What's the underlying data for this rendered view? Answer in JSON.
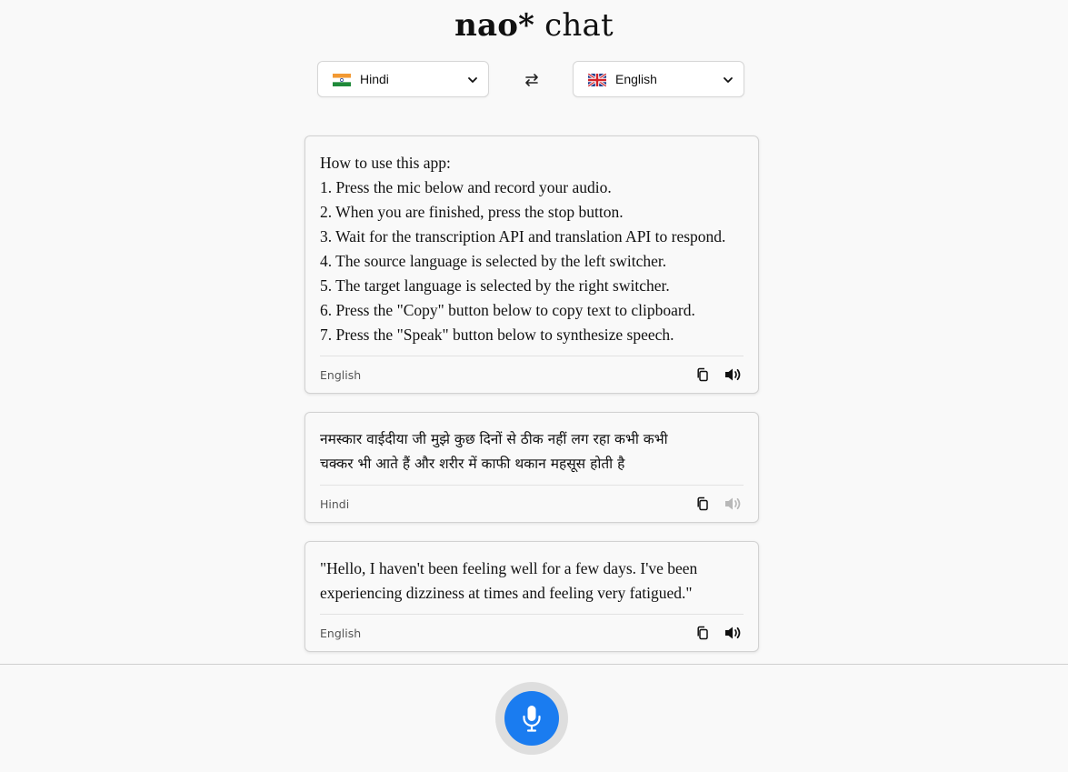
{
  "app": {
    "title_bold": "nao*",
    "title_light": "chat"
  },
  "language_bar": {
    "source": {
      "label": "Hindi",
      "flag": "india-flag-icon"
    },
    "target": {
      "label": "English",
      "flag": "uk-flag-icon"
    },
    "swap_icon": "swap-arrows-icon"
  },
  "messages": [
    {
      "lines": [
        "How to use this app:",
        "1. Press the mic below and record your audio.",
        "2. When you are finished, press the stop button.",
        "3. Wait for the transcription API and translation API to respond.",
        "4. The source language is selected by the left switcher.",
        "5. The target language is selected by the right switcher.",
        "6. Press the \"Copy\" button below to copy text to clipboard.",
        "7. Press the \"Speak\" button below to synthesize speech."
      ],
      "language": "English",
      "speak_enabled": true
    },
    {
      "lines": [
        "नमस्कार वाईदीया जी मुझे कुछ दिनों से ठीक नहीं लग रहा कभी कभी",
        "चक्कर भी आते हैं और शरीर में काफी थकान महसूस होती है"
      ],
      "language": "Hindi",
      "speak_enabled": false
    },
    {
      "lines": [
        "\"Hello, I haven't been feeling well for a few days. I've been",
        "experiencing dizziness at times and feeling very fatigued.\""
      ],
      "language": "English",
      "speak_enabled": true
    }
  ],
  "colors": {
    "accent": "#1a7cf0",
    "disabled_icon": "#b8b8b8"
  },
  "icons": {
    "copy": "copy-icon",
    "speak": "speaker-icon",
    "mic": "microphone-icon"
  }
}
